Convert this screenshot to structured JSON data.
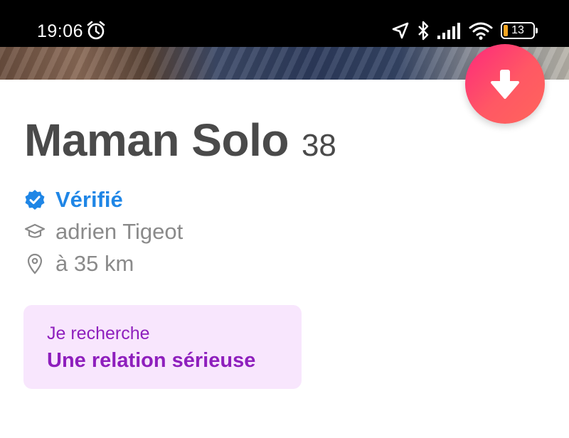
{
  "status_bar": {
    "time": "19:06",
    "battery_level": "13",
    "icons": [
      "alarm-icon",
      "location-arrow-icon",
      "bluetooth-icon",
      "cellular-signal-icon",
      "wifi-icon",
      "battery-icon"
    ]
  },
  "profile": {
    "name": "Maman Solo",
    "age": "38",
    "verified_label": "Vérifié",
    "school": "adrien Tigeot",
    "distance": "à 35 km"
  },
  "looking_for": {
    "label": "Je recherche",
    "value": "Une relation sérieuse"
  },
  "action_button": {
    "icon": "arrow-down-icon"
  },
  "colors": {
    "accent_gradient_start": "#fd297b",
    "accent_gradient_end": "#ff655b",
    "verified_blue": "#1f86e6",
    "card_background": "#f8e6fd",
    "card_text": "#8e1fbd",
    "name_text": "#4a4a4a",
    "secondary_text": "#8a8a8a"
  }
}
